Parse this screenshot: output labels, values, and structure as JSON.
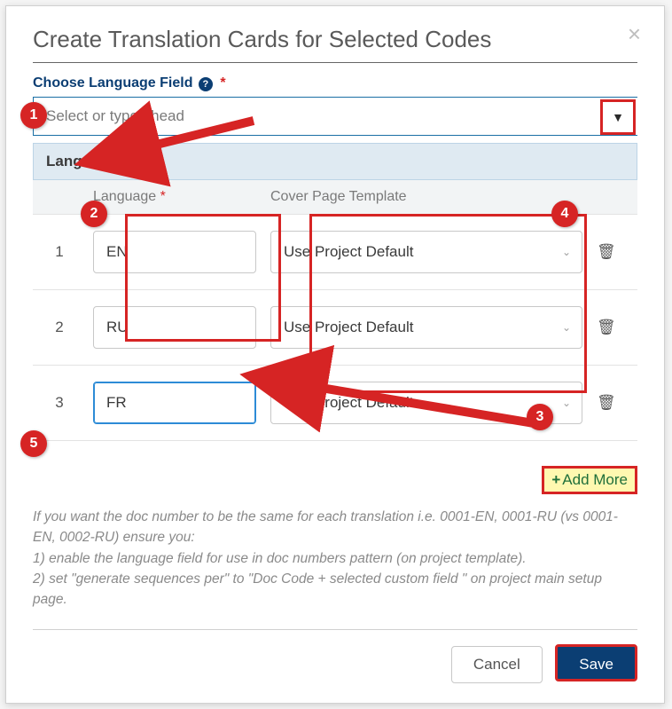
{
  "modal": {
    "title": "Create Translation Cards for Selected Codes"
  },
  "fieldLabel": "Choose Language Field",
  "select": {
    "placeholder": "Select or type ahead"
  },
  "languageHeader": "Language",
  "columns": {
    "language": "Language",
    "template": "Cover Page Template"
  },
  "rows": [
    {
      "num": "1",
      "lang": "EN",
      "template": "Use Project Default"
    },
    {
      "num": "2",
      "lang": "RU",
      "template": "Use Project Default"
    },
    {
      "num": "3",
      "lang": "FR",
      "template": "Use Project Default"
    }
  ],
  "addMore": "Add More",
  "hint": {
    "intro": "If you want the doc number to be the same for each translation i.e. 0001-EN, 0001-RU (vs 0001-EN, 0002-RU) ensure you:",
    "l1": "1)  enable the language field for use in doc numbers pattern (on project template).",
    "l2": "2)  set \"generate sequences per\" to \"Doc Code + selected custom field \" on project main setup page."
  },
  "buttons": {
    "cancel": "Cancel",
    "save": "Save"
  },
  "annotations": [
    "1",
    "2",
    "3",
    "4",
    "5"
  ]
}
